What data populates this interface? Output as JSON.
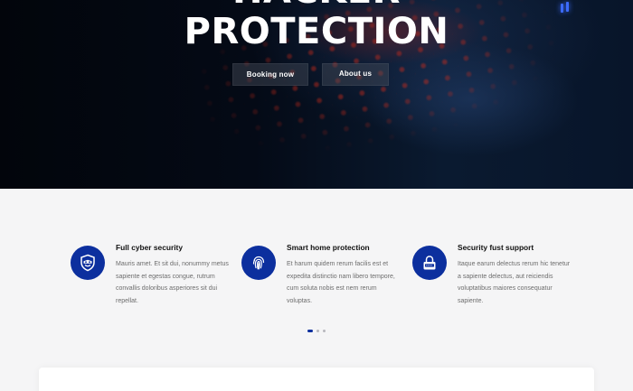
{
  "hero": {
    "title_line1": "HACKER",
    "title_line2": "PROTECTION",
    "booking_button": "Booking now",
    "about_button": "About us"
  },
  "features": [
    {
      "title": "Full cyber security",
      "text": "Mauris amet. Et sit dui, nonummy metus sapiente et egestas congue, rutrum convallis doloribus asperiores sit dui repellat.",
      "icon": "shield-icon"
    },
    {
      "title": "Smart home protection",
      "text": "Et harum quidem rerum facilis est et expedita distinctio nam libero tempore, cum soluta nobis est nem rerum voluptas.",
      "icon": "fingerprint-icon"
    },
    {
      "title": "Security fust support",
      "text": "Itaque earum delectus rerum hic tenetur a sapiente delectus, aut reiciendis voluptatibus maiores consequatur sapiente.",
      "icon": "lock-icon"
    }
  ],
  "carousel": {
    "slides": 3,
    "active": 1
  },
  "colors": {
    "accent": "#0c2f9e",
    "hero_bg": "#040a16",
    "section_bg": "#f5f5f6"
  }
}
